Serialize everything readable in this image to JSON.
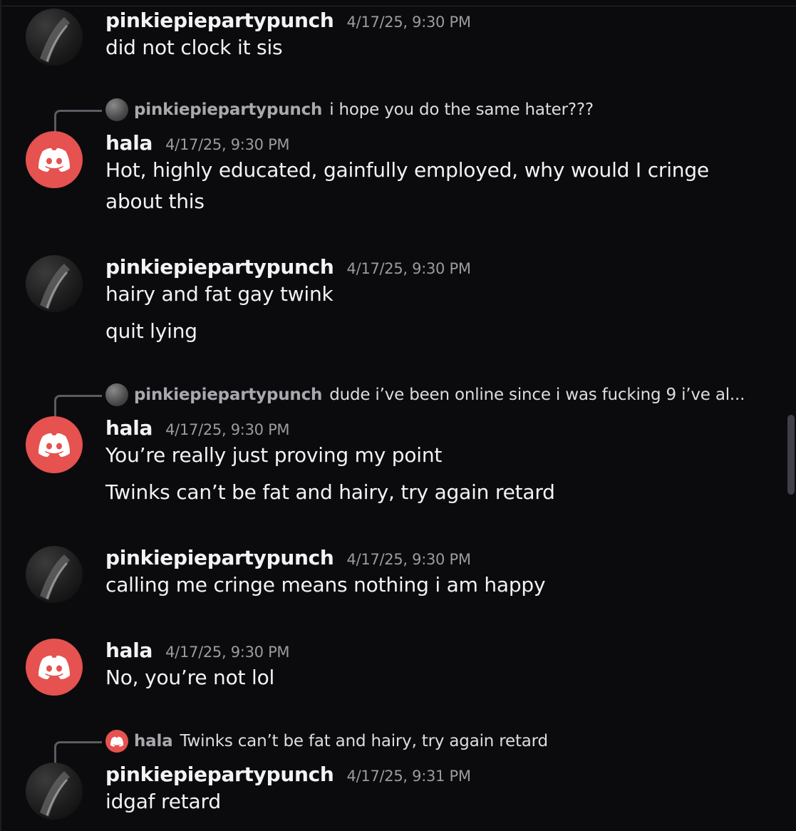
{
  "colors": {
    "background": "#0b0b0d",
    "discord_avatar": "#e5524f",
    "timestamp": "#9a9ba0"
  },
  "icons": {
    "discord_avatar": "discord-logo-icon",
    "user_avatar": "profile-photo"
  },
  "messages": [
    {
      "author": "pinkiepiepartypunch",
      "timestamp": "4/17/25, 9:30 PM",
      "avatar": "photo",
      "lines": [
        "did not clock it sis"
      ]
    },
    {
      "reply": {
        "author": "pinkiepiepartypunch",
        "text": "i hope you do the same hater???",
        "avatar": "photo"
      },
      "author": "hala",
      "timestamp": "4/17/25, 9:30 PM",
      "avatar": "discord",
      "lines": [
        "Hot, highly educated, gainfully employed, why would I cringe",
        "about this"
      ]
    },
    {
      "author": "pinkiepiepartypunch",
      "timestamp": "4/17/25, 9:30 PM",
      "avatar": "photo",
      "lines": [
        "hairy and fat gay twink",
        "quit lying"
      ]
    },
    {
      "reply": {
        "author": "pinkiepiepartypunch",
        "text": "dude i’ve been online since i was fucking 9 i’ve al...",
        "avatar": "photo"
      },
      "author": "hala",
      "timestamp": "4/17/25, 9:30 PM",
      "avatar": "discord",
      "lines": [
        "You’re really just proving my point",
        "Twinks can’t be fat and hairy, try again retard"
      ]
    },
    {
      "author": "pinkiepiepartypunch",
      "timestamp": "4/17/25, 9:30 PM",
      "avatar": "photo",
      "lines": [
        "calling me cringe means nothing i am happy"
      ]
    },
    {
      "author": "hala",
      "timestamp": "4/17/25, 9:30 PM",
      "avatar": "discord",
      "lines": [
        "No, you’re not lol"
      ]
    },
    {
      "reply": {
        "author": "hala",
        "text": "Twinks can’t be fat and hairy, try again retard",
        "avatar": "discord"
      },
      "author": "pinkiepiepartypunch",
      "timestamp": "4/17/25, 9:31 PM",
      "avatar": "photo",
      "lines": [
        "idgaf retard"
      ]
    }
  ]
}
